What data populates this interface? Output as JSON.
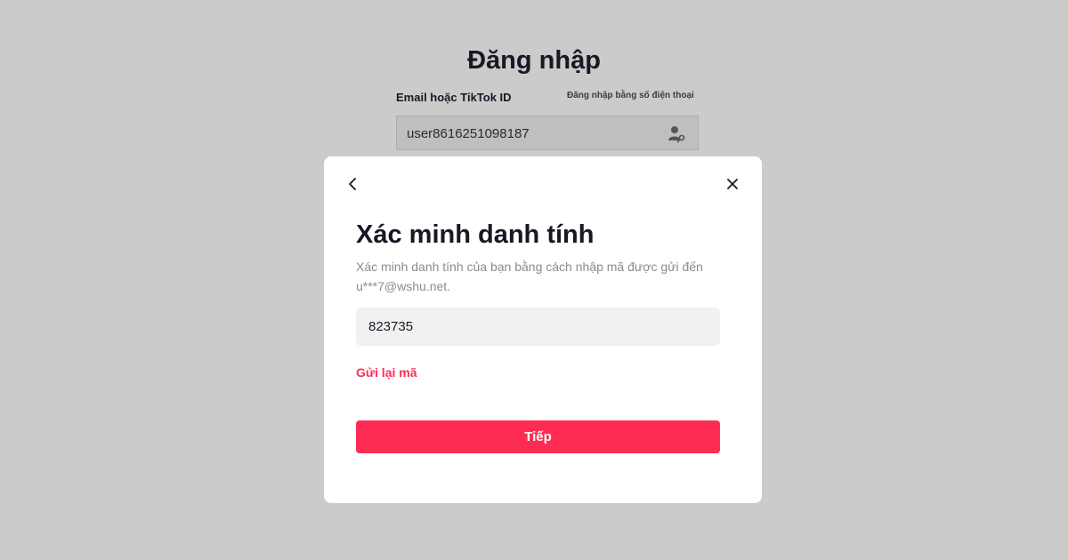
{
  "background": {
    "title": "Đăng nhập",
    "field_label": "Email hoặc TikTok ID",
    "phone_login_link": "Đăng nhập bằng số điện thoại",
    "identifier_value": "user8616251098187",
    "identifier_icon": "user-key-icon"
  },
  "modal": {
    "back_icon": "chevron-left-icon",
    "close_icon": "close-icon",
    "title": "Xác minh danh tính",
    "description": "Xác minh danh tính của bạn bằng cách nhập mã được gửi đến u***7@wshu.net.",
    "code_value": "823735",
    "resend_label": "Gửi lại mã",
    "next_label": "Tiếp"
  },
  "colors": {
    "accent": "#fe2c55",
    "overlay_bg": "#cbcbcb",
    "modal_bg": "#ffffff"
  }
}
